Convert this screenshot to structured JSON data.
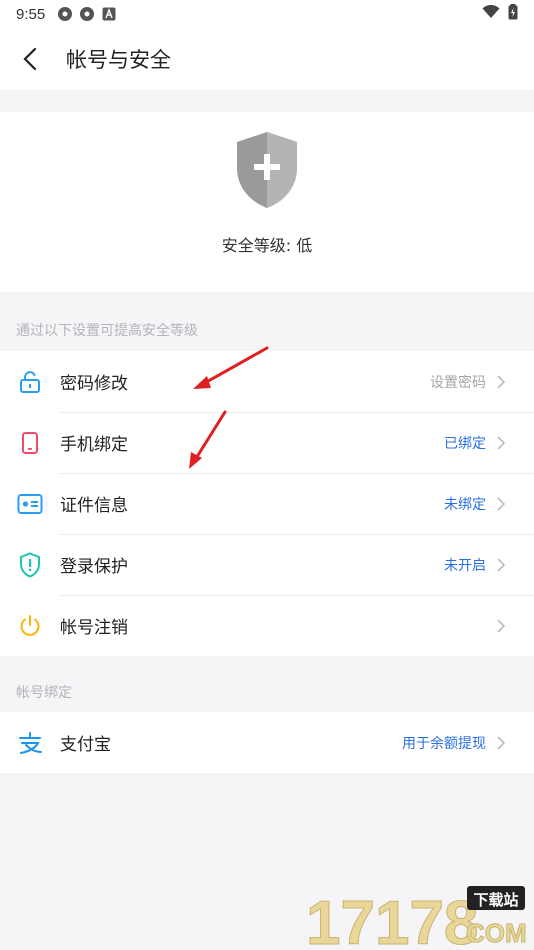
{
  "status_bar": {
    "time": "9:55"
  },
  "header": {
    "title": "帐号与安全"
  },
  "hero": {
    "security_level": "安全等级: 低"
  },
  "section1": {
    "label": "通过以下设置可提高安全等级",
    "items": [
      {
        "label": "密码修改",
        "status": "设置密码",
        "status_color": "#a5a5aa",
        "icon": "unlock-icon"
      },
      {
        "label": "手机绑定",
        "status": "已绑定",
        "status_color": "#2a6fe0",
        "icon": "phone-icon"
      },
      {
        "label": "证件信息",
        "status": "未绑定",
        "status_color": "#2a6fe0",
        "icon": "id-card-icon"
      },
      {
        "label": "登录保护",
        "status": "未开启",
        "status_color": "#2a6fe0",
        "icon": "shield-exclaim-icon"
      },
      {
        "label": "帐号注销",
        "status": "",
        "status_color": "",
        "icon": "power-icon"
      }
    ]
  },
  "section2": {
    "label": "帐号绑定",
    "items": [
      {
        "label": "支付宝",
        "status": "用于余额提现",
        "status_color": "#2a6fe0",
        "icon": "alipay-icon"
      }
    ]
  },
  "watermark": {
    "text": "17178",
    "badge": "下载站",
    "suffix": "COM"
  },
  "colors": {
    "blue": "#2a6fe0",
    "gray_text": "#a5a5aa",
    "arrow_red": "#e02020"
  }
}
